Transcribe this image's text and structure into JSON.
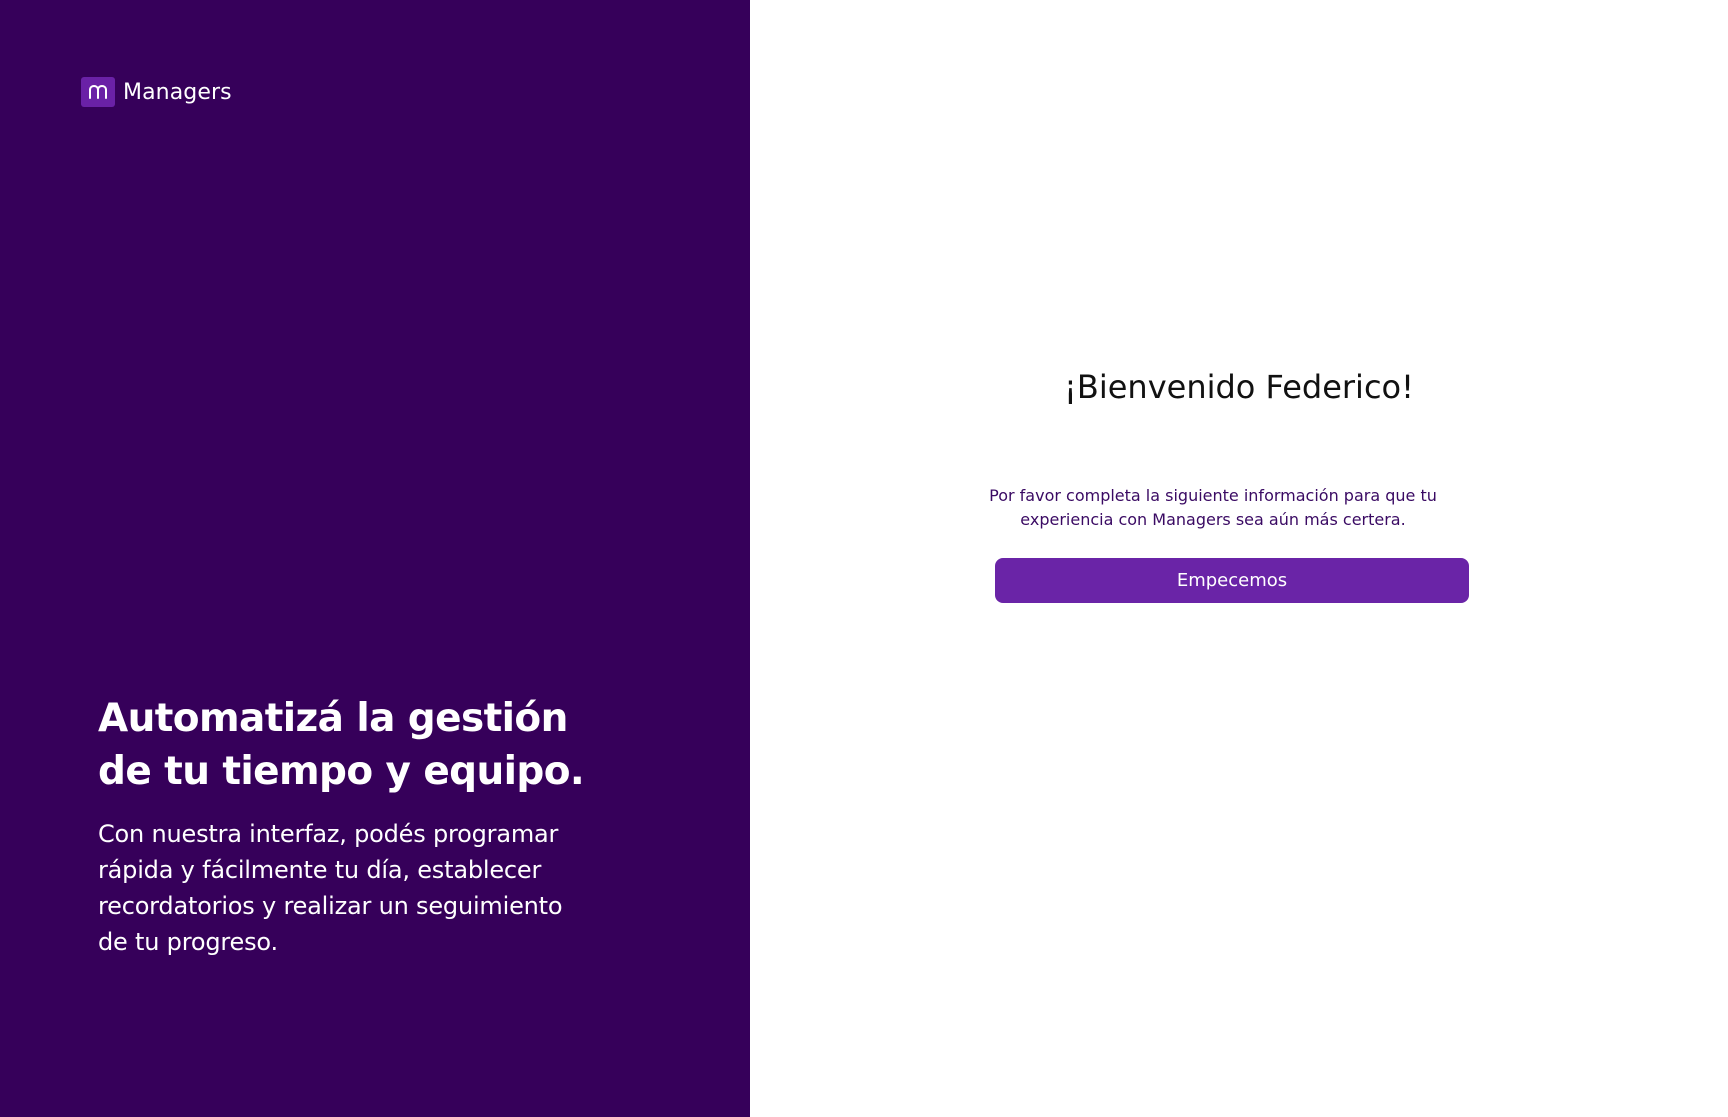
{
  "brand": {
    "name": "Managers",
    "icon": "managers-logo-icon",
    "mark_color": "#6a21a6"
  },
  "left_panel": {
    "background_color": "#36005a",
    "headline": "Automatizá la gestión de tu tiempo y equipo.",
    "description": "Con nuestra interfaz, podés programar rápida y fácilmente tu día, establecer recordatorios y realizar un seguimiento de tu progreso."
  },
  "right_panel": {
    "welcome_title": "¡Bienvenido Federico!",
    "subtitle": "Por favor completa la siguiente información para que tu experiencia con Managers sea aún más certera.",
    "cta_label": "Empecemos",
    "cta_color": "#6a24a7",
    "subtitle_color": "#3a0a63"
  }
}
